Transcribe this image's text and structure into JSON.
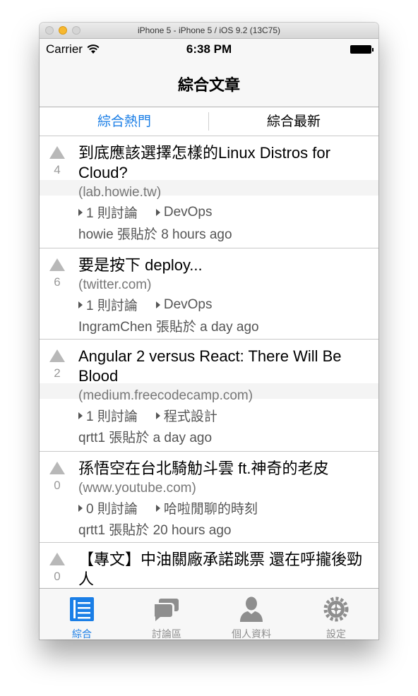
{
  "window": {
    "title": "iPhone 5 - iPhone 5 / iOS 9.2 (13C75)"
  },
  "statusbar": {
    "carrier": "Carrier",
    "time": "6:38 PM"
  },
  "navbar": {
    "title": "綜合文章"
  },
  "segments": [
    "綜合熱門",
    "綜合最新"
  ],
  "posts": [
    {
      "votes": "4",
      "title": "到底應該選擇怎樣的Linux Distros for Cloud?",
      "domain": "(lab.howie.tw)",
      "comments": "1 則討論",
      "category": "DevOps",
      "poster": "howie 張貼於 8 hours ago"
    },
    {
      "votes": "6",
      "title": "要是按下 deploy...",
      "domain": "(twitter.com)",
      "comments": "1 則討論",
      "category": "DevOps",
      "poster": "IngramChen 張貼於 a day ago"
    },
    {
      "votes": "2",
      "title": "Angular 2 versus React: There Will Be Blood",
      "domain": "(medium.freecodecamp.com)",
      "comments": "1 則討論",
      "category": "程式設計",
      "poster": "qrtt1 張貼於 a day ago"
    },
    {
      "votes": "0",
      "title": "孫悟空在台北騎觔斗雲 ft.神奇的老皮",
      "domain": "(www.youtube.com)",
      "comments": "0 則討論",
      "category": "哈啦閒聊的時刻",
      "poster": "qrtt1 張貼於 20 hours ago"
    },
    {
      "votes": "0",
      "title": "【專文】中油關廠承諾跳票 還在呼攏後勁人",
      "domain": "",
      "comments": "",
      "category": "",
      "poster": ""
    }
  ],
  "tabs": [
    {
      "label": "綜合",
      "icon": "list-icon"
    },
    {
      "label": "討論區",
      "icon": "chat-bubbles-icon"
    },
    {
      "label": "個人資料",
      "icon": "person-icon"
    },
    {
      "label": "設定",
      "icon": "gear-icon"
    }
  ],
  "colors": {
    "accent": "#1a7ee6",
    "inactive": "#8e8e8e"
  }
}
